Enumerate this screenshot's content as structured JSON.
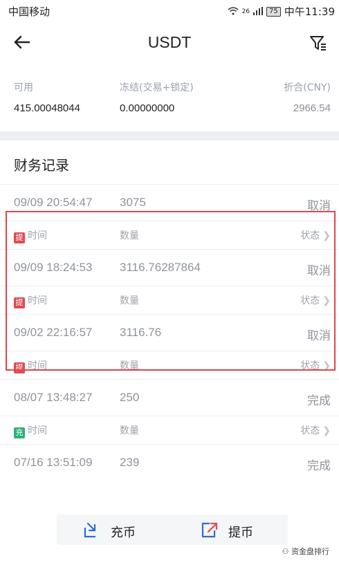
{
  "status_bar": {
    "carrier": "中国移动",
    "signal": "26",
    "battery": "75",
    "time": "中午11:39"
  },
  "header": {
    "title": "USDT"
  },
  "balance": {
    "available_label": "可用",
    "available_value": "415.00048044",
    "frozen_label": "冻结(交易+锁定)",
    "frozen_value": "0.00000000",
    "cny_label": "折合(CNY)",
    "cny_value": "2966.54"
  },
  "records": {
    "title": "财务记录",
    "rows": [
      {
        "type": "data",
        "time": "09/09 20:54:47",
        "amount": "3075",
        "status": "取消"
      },
      {
        "type": "header",
        "tag": "提",
        "tag_color": "#e24a4f",
        "time_label": "时间",
        "amount_label": "数量",
        "status_label": "状态"
      },
      {
        "type": "data",
        "time": "09/09 18:24:53",
        "amount": "3116.76287864",
        "status": "取消"
      },
      {
        "type": "header",
        "tag": "提",
        "tag_color": "#e24a4f",
        "time_label": "时间",
        "amount_label": "数量",
        "status_label": "状态"
      },
      {
        "type": "data",
        "time": "09/02 22:16:57",
        "amount": "3116.76",
        "status": "取消"
      },
      {
        "type": "header",
        "tag": "提",
        "tag_color": "#e24a4f",
        "time_label": "时间",
        "amount_label": "数量",
        "status_label": "状态"
      },
      {
        "type": "data",
        "time": "08/07 13:48:27",
        "amount": "250",
        "status": "完成"
      },
      {
        "type": "header",
        "tag": "充",
        "tag_color": "#2db07a",
        "time_label": "时间",
        "amount_label": "数量",
        "status_label": "状态"
      },
      {
        "type": "data",
        "time": "07/16 13:51:09",
        "amount": "239",
        "status": "完成"
      }
    ]
  },
  "bottom": {
    "deposit_label": "充币",
    "withdraw_label": "提币"
  },
  "watermark": "资金盘排行",
  "colors": {
    "highlight": "#e0454a",
    "accent": "#2c6bd6"
  }
}
